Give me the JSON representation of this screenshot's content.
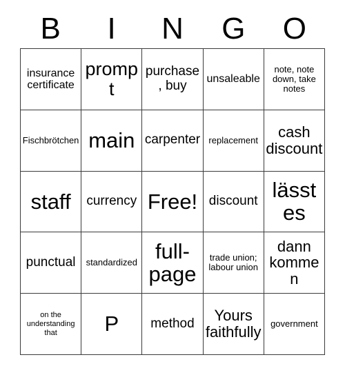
{
  "card": {
    "title": "BINGO",
    "header_letters": [
      "B",
      "I",
      "N",
      "G",
      "O"
    ],
    "free_space_label": "Free!",
    "grid": [
      [
        {
          "text": "insurance certificate",
          "size": "sm"
        },
        {
          "text": "prompt",
          "size": "xl"
        },
        {
          "text": "purchase, buy",
          "size": "md"
        },
        {
          "text": "unsaleable",
          "size": "sm"
        },
        {
          "text": "note, note down, take notes",
          "size": "xs"
        }
      ],
      [
        {
          "text": "Fischbrötchen",
          "size": "xs"
        },
        {
          "text": "main",
          "size": "xxl"
        },
        {
          "text": "carpenter",
          "size": "md"
        },
        {
          "text": "replacement",
          "size": "xs"
        },
        {
          "text": "cash discount",
          "size": "lg"
        }
      ],
      [
        {
          "text": "staff",
          "size": "xxl"
        },
        {
          "text": "currency",
          "size": "md"
        },
        {
          "text": "Free!",
          "size": "xxl"
        },
        {
          "text": "discount",
          "size": "md"
        },
        {
          "text": "lässt es",
          "size": "xxl"
        }
      ],
      [
        {
          "text": "punctual",
          "size": "md"
        },
        {
          "text": "standardized",
          "size": "xs"
        },
        {
          "text": "full-page",
          "size": "xxl"
        },
        {
          "text": "trade union; labour union",
          "size": "xs"
        },
        {
          "text": "dann kommen",
          "size": "lg"
        }
      ],
      [
        {
          "text": "on the understanding that",
          "size": "xxs"
        },
        {
          "text": "P",
          "size": "xxl"
        },
        {
          "text": "method",
          "size": "md"
        },
        {
          "text": "Yours faithfully",
          "size": "lg"
        },
        {
          "text": "government",
          "size": "xs"
        }
      ]
    ]
  }
}
